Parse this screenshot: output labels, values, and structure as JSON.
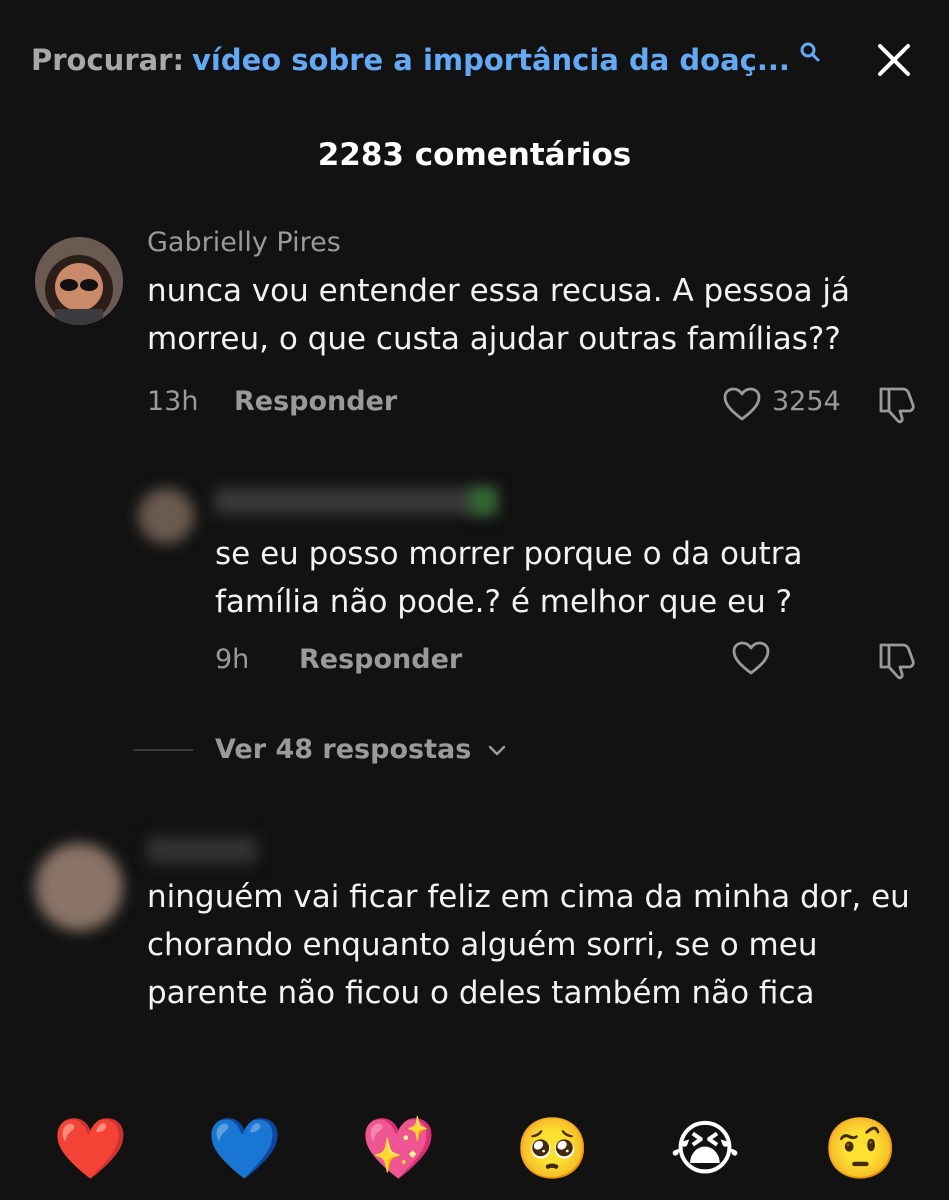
{
  "search": {
    "label": "Procurar:",
    "query": "vídeo sobre a importância da doaç..."
  },
  "comments_header": {
    "title": "2283 comentários"
  },
  "comments": [
    {
      "author": "Gabrielly Pires",
      "text": "nunca vou entender essa recusa. A pessoa já morreu, o que custa ajudar outras famílias??",
      "time": "13h",
      "reply_label": "Responder",
      "likes": "3254"
    },
    {
      "author": "",
      "text": "se eu posso morrer porque o da outra família não pode.? é melhor que eu ?",
      "time": "9h",
      "reply_label": "Responder"
    },
    {
      "author": "",
      "text": "ninguém vai ficar feliz em cima da minha dor, eu chorando enquanto alguém sorri, se o meu parente não ficou o deles também não fica"
    }
  ],
  "view_replies": {
    "label": "Ver 48 respostas"
  },
  "quick_reactions": [
    {
      "emoji": "❤️",
      "name": "red-heart"
    },
    {
      "emoji": "💙",
      "name": "blue-heart"
    },
    {
      "emoji": "💖",
      "name": "sparkling-heart"
    },
    {
      "emoji": "🥺",
      "name": "pleading-face"
    },
    {
      "emoji": "😭",
      "name": "loudly-crying-face"
    },
    {
      "emoji": "🤨",
      "name": "raised-eyebrow-face"
    }
  ],
  "colors": {
    "background": "#121212",
    "query_link": "#63a9f4",
    "muted_text": "#9a9a9a"
  }
}
